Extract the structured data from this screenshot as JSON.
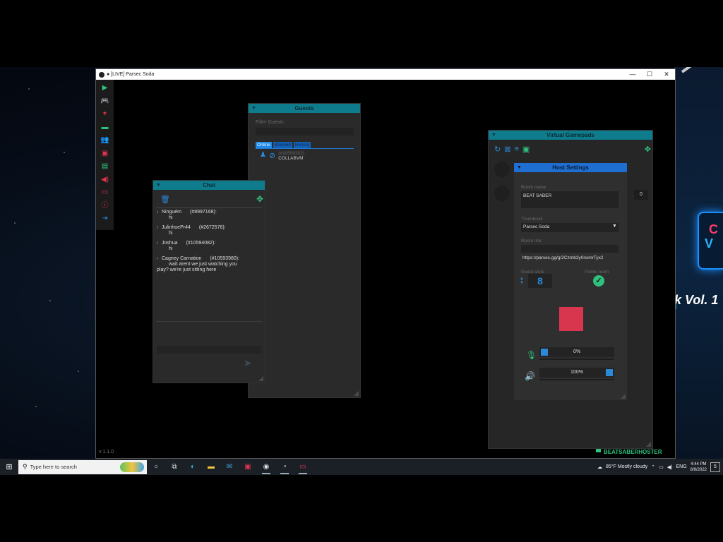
{
  "window": {
    "title": "● [LIVE] Parsec Soda",
    "controls": [
      "—",
      "☐",
      "✕"
    ],
    "version": "v 1.1.0"
  },
  "toolbar": {
    "items": [
      {
        "name": "play-icon",
        "glyph": "▶",
        "color": "#2ec27e"
      },
      {
        "name": "gamepad-icon",
        "glyph": "🎮",
        "color": "#2ec27e"
      },
      {
        "name": "bird-icon",
        "glyph": "✶",
        "color": "#e0344e"
      },
      {
        "name": "chat-icon",
        "glyph": "▬",
        "color": "#2ec27e"
      },
      {
        "name": "users-icon",
        "glyph": "👥",
        "color": "#2ec27e"
      },
      {
        "name": "image-icon",
        "glyph": "▣",
        "color": "#e0344e"
      },
      {
        "name": "book-icon",
        "glyph": "▤",
        "color": "#2ec27e"
      },
      {
        "name": "speaker-icon",
        "glyph": "◀)",
        "color": "#e0344e"
      },
      {
        "name": "monitor-icon",
        "glyph": "▭",
        "color": "#e0344e"
      },
      {
        "name": "info-icon",
        "glyph": "ⓘ",
        "color": "#e0344e"
      },
      {
        "name": "exit-icon",
        "glyph": "⇥",
        "color": "#2a8ad9"
      }
    ]
  },
  "guests": {
    "title": "Guests",
    "filter_label": "Filter Guests",
    "filter_value": "",
    "tabs": [
      "Online",
      "Blocked",
      "History"
    ],
    "active_tab": "Online",
    "rows": [
      {
        "id": "(#10599302)",
        "name": "COLLABVM"
      }
    ]
  },
  "chat": {
    "title": "Chat",
    "messages": [
      {
        "user": "Ninguém",
        "uid": "(#8997168):",
        "lines": [
          "hi"
        ]
      },
      {
        "user": "JulinhoePr44",
        "uid": "(#2672578):",
        "lines": [
          "hi"
        ]
      },
      {
        "user": "Joshua",
        "uid": "(#10594082):",
        "lines": [
          "hi"
        ]
      },
      {
        "user": "Cagney Carnation",
        "uid": "(#10593980):",
        "lines": [
          "wait arent we just watching you",
          "play? we're just sitting here"
        ]
      }
    ],
    "input_value": ""
  },
  "gamepads": {
    "title": "Virtual Gamepads",
    "host_settings": {
      "title": "Host Settings",
      "room_name_label": "Room name",
      "room_name": "BEAT SABER",
      "thumbnail_label": "Thumbnail",
      "thumbnail": "Parsec Soda",
      "room_link_label": "Room link",
      "room_link": "https://parsec.gg/g/2Czmb3y0nxmrTyx2",
      "guest_slots_label": "Guest slots",
      "guest_slots": "8",
      "public_room_label": "Public room",
      "public_room": true,
      "room_color": "#d8354f",
      "mic_volume_text": "0%",
      "mic_volume_fraction": 0,
      "speaker_volume_text": "100%",
      "speaker_volume_fraction": 1
    },
    "badge": "0"
  },
  "game": {
    "title_fragment": "k Vol. 1",
    "card_top": "C",
    "card_bottom": "V"
  },
  "overlay_user": "BEATSABERHOSTER",
  "taskbar": {
    "search_placeholder": "Type here to search",
    "weather": "85°F  Mostly cloudy",
    "lang": "ENG",
    "time": "4:44 PM",
    "date": "8/9/2022",
    "notif_count": "5"
  }
}
